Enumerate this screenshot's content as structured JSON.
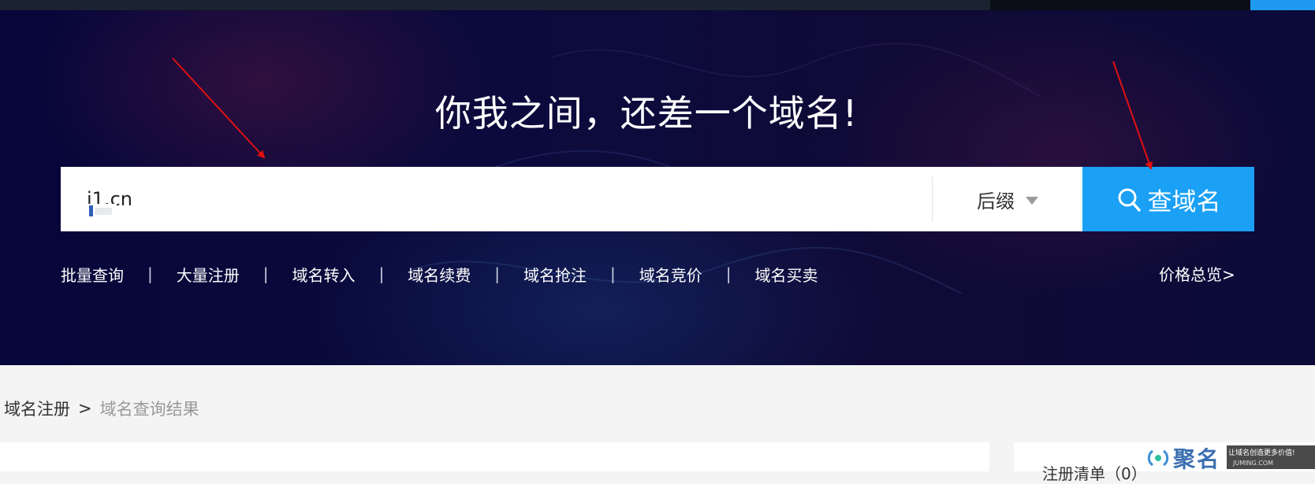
{
  "hero": {
    "title": "你我之间，还差一个域名!"
  },
  "search": {
    "value": "i1.cn",
    "suffix_label": "后缀",
    "button_label": "查域名"
  },
  "nav": {
    "items": [
      "批量查询",
      "大量注册",
      "域名转入",
      "域名续费",
      "域名抢注",
      "域名竞价",
      "域名买卖"
    ],
    "separator": "|",
    "price_overview": "价格总览>"
  },
  "breadcrumb": {
    "root": "域名注册",
    "separator": ">",
    "current": "域名查询结果"
  },
  "sidebar": {
    "cart_label": "注册清单（0）"
  },
  "watermark": {
    "brand": "聚名",
    "slogan": "让域名创造更多价值!",
    "domain": "JUMING.COM"
  },
  "colors": {
    "accent": "#1aa0f5",
    "hero_bg": "#0a0a3a",
    "annotation_arrow": "#e01010"
  }
}
